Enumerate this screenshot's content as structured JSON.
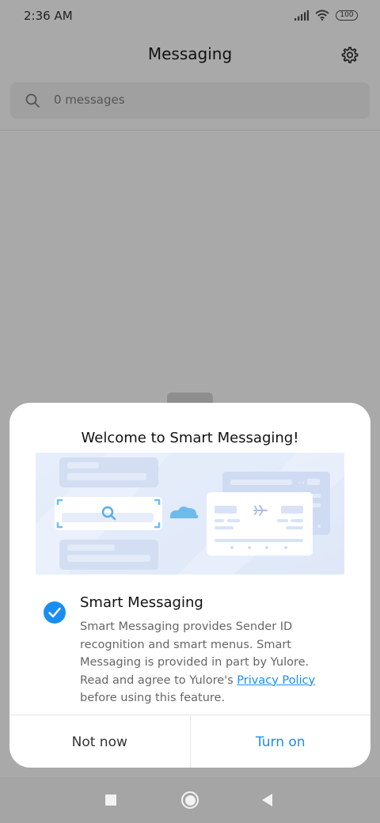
{
  "status_bar": {
    "time": "2:36 AM",
    "battery": "100",
    "icons": [
      "signal-icon",
      "wifi-icon",
      "battery-icon"
    ]
  },
  "header": {
    "title": "Messaging",
    "settings_icon": "gear-icon"
  },
  "search": {
    "placeholder": "0 messages"
  },
  "dialog": {
    "title": "Welcome to Smart Messaging!",
    "feature_title": "Smart Messaging",
    "feature_checked": true,
    "description_prefix": "Smart Messaging provides Sender ID recognition and smart menus. Smart Messaging is provided in part by Yulore. Read and agree to Yulore's",
    "privacy_link": "Privacy Policy",
    "description_suffix": "before using this feature.",
    "not_now_label": "Not now",
    "turn_on_label": "Turn on"
  },
  "colors": {
    "accent": "#1a8ef0",
    "overlay": "#a9a9a9",
    "dialog_bg": "#ffffff"
  },
  "nav_bar": {
    "icons": [
      "recent-apps-icon",
      "home-icon",
      "back-icon"
    ]
  }
}
